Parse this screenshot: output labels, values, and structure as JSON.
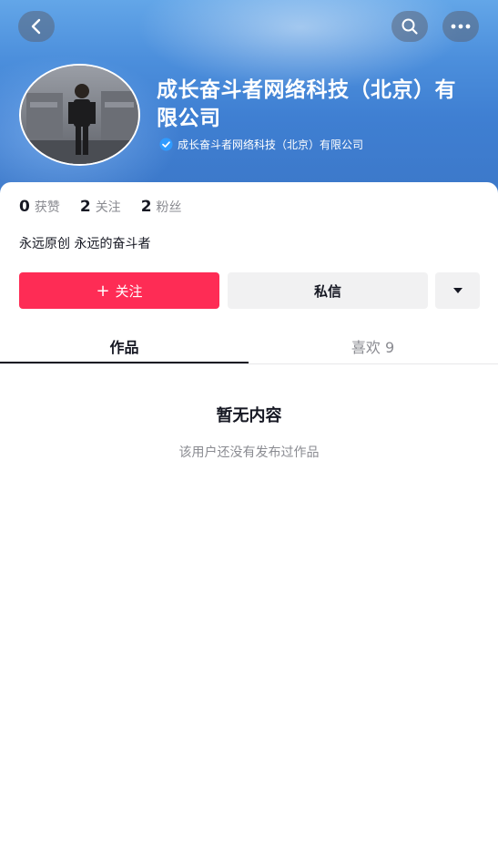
{
  "header": {
    "name": "成长奋斗者网络科技（北京）有限公司",
    "verified_label": "成长奋斗者网络科技（北京）有限公司",
    "back_icon": "chevron-left-icon",
    "search_icon": "search-icon",
    "more_icon": "more-horizontal-icon"
  },
  "stats": [
    {
      "value": "0",
      "label": "获赞"
    },
    {
      "value": "2",
      "label": "关注"
    },
    {
      "value": "2",
      "label": "粉丝"
    }
  ],
  "bio": "永远原创 永远的奋斗者",
  "actions": {
    "follow_label": "关注",
    "follow_plus": "+",
    "message_label": "私信",
    "dropdown_icon": "caret-down-icon"
  },
  "tabs": {
    "works": "作品",
    "likes": "喜欢 9"
  },
  "empty": {
    "title": "暂无内容",
    "subtitle": "该用户还没有发布过作品"
  },
  "colors": {
    "accent": "#fe2c55",
    "header_blue": "#4c8fdc",
    "secondary_button": "#f1f1f2",
    "text_muted": "#8a8b91"
  }
}
